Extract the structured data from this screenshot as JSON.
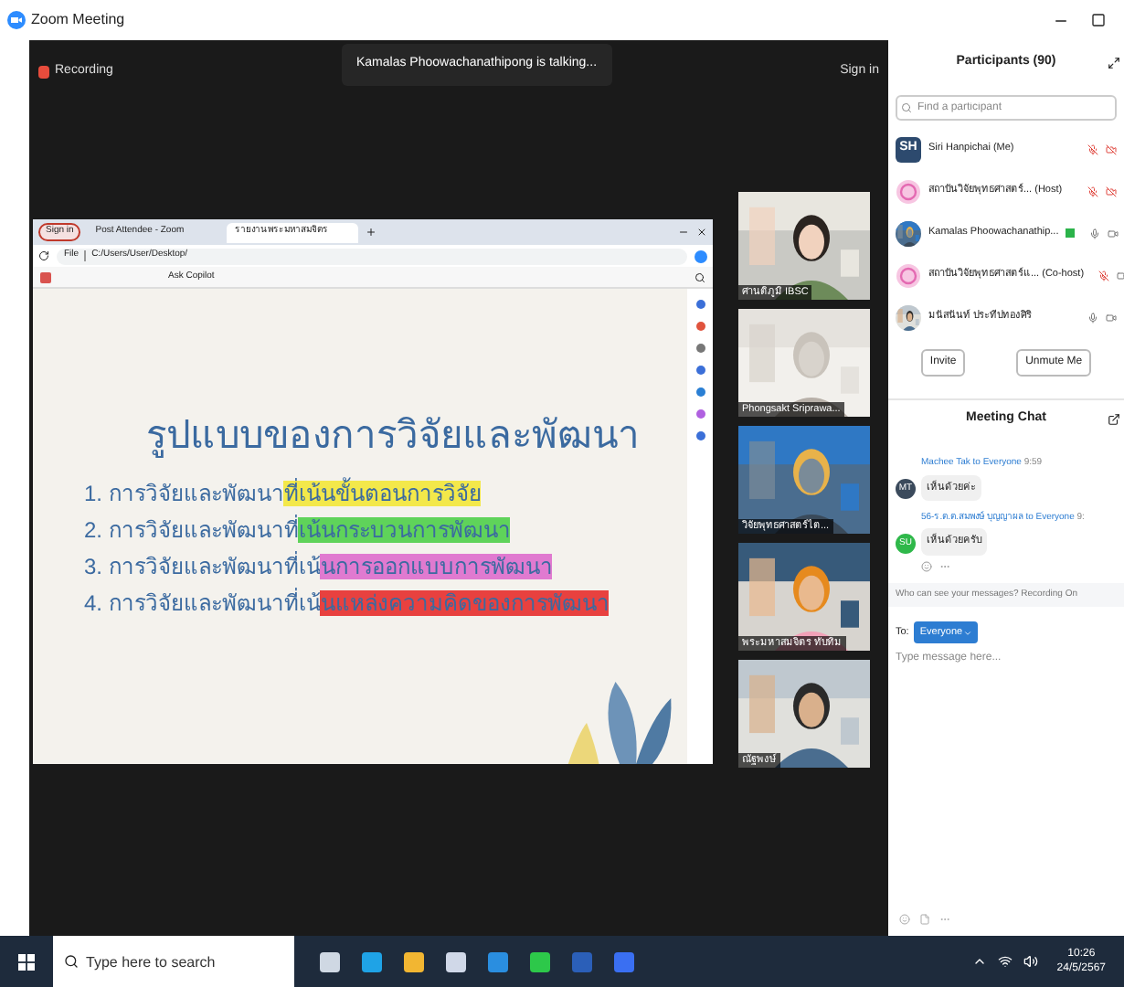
{
  "window": {
    "title": "Zoom Meeting"
  },
  "meeting": {
    "recording": "Recording",
    "talking": "Kamalas Phoowachanathipong is talking...",
    "sign_in": "Sign in"
  },
  "browser": {
    "sign_in": "Sign in",
    "tabs": [
      {
        "label": "Post Attendee - Zoom",
        "selected": false
      },
      {
        "label": "รายงาน พระมหาสมจิตร",
        "selected": true
      }
    ],
    "file": "File",
    "address": "C:/Users/User/Desktop/",
    "copilot": "Ask Copilot"
  },
  "slide": {
    "title": "รูปแบบของการวิจัยและพัฒนา",
    "items": [
      {
        "number": "1.",
        "text": "การวิจัยและพัฒนา",
        "highlight": "ที่เน้นขั้นตอนการวิจัย",
        "color": "#f3e84a"
      },
      {
        "number": "2.",
        "text": "การวิจัยและพัฒนาที่",
        "highlight": "เน้นกระบวนการพัฒนา",
        "color": "#5fd35a"
      },
      {
        "number": "3.",
        "text": "การวิจัยและพัฒนาที่เน้",
        "highlight": "นการออกแบบการพัฒนา",
        "color": "#e07ad0"
      },
      {
        "number": "4.",
        "text": "การวิจัยและพัฒนาที่เน้",
        "highlight": "นแหล่งความคิดของการพัฒนา",
        "color": "#e8413f"
      }
    ]
  },
  "videos": [
    {
      "name": "ศานติภูมิ IBSC"
    },
    {
      "name": "Phongsakt Sriprawa..."
    },
    {
      "name": "วิจัยพุทธศาสตร์ไต..."
    },
    {
      "name": "พระมหาสมจิตร ทับทิม"
    },
    {
      "name": "ณัฐพงษ์"
    }
  ],
  "participants": {
    "title": "Participants (90)",
    "search": {
      "placeholder": "Find a participant"
    },
    "rows": [
      {
        "avatar": {
          "kind": "initials",
          "text": "SH"
        },
        "name": "Siri Hanpichai (Me)",
        "sharing": false,
        "muted": true,
        "video_off": true
      },
      {
        "avatar": {
          "kind": "logo"
        },
        "name": "สถาบันวิจัยพุทธศาสตร์... (Host)",
        "sharing": false,
        "muted": true,
        "video_off": true
      },
      {
        "name": "Kamalas Phoowachanathip...",
        "sharing": true,
        "muted": false,
        "video_off": false
      },
      {
        "avatar": {
          "kind": "logo"
        },
        "name": "สถาบันวิจัยพุทธศาสตร์แ... (Co-host)",
        "sharing": false,
        "muted": true,
        "video_off": false
      },
      {
        "name": "มนัสนันท์ ประทีปทองศิริ",
        "sharing": false,
        "muted": false,
        "video_off": false
      }
    ],
    "buttons": [
      "Invite",
      "Unmute Me"
    ]
  },
  "chat": {
    "title": "Meeting Chat",
    "messages": [
      {
        "initials": "MT",
        "color": "#3b4a5c",
        "sender": "Machee Tak",
        "to": "to Everyone",
        "time": "9:59",
        "text": "เห็นด้วยค่ะ"
      },
      {
        "initials": "SU",
        "color": "#2fb84a",
        "sender": "56-ร.ต.ต.สมพงษ์ บุญญาผล",
        "to": "to Everyone",
        "time": "9:",
        "text": "เห็นด้วยครับ"
      }
    ],
    "notice": "Who can see your messages? Recording On",
    "to_label": "To:",
    "recipient": "Everyone",
    "placeholder": "Type message here..."
  },
  "taskbar": {
    "search": {
      "placeholder": "Type here to search"
    },
    "time": "10:26",
    "date": "24/5/2567"
  }
}
